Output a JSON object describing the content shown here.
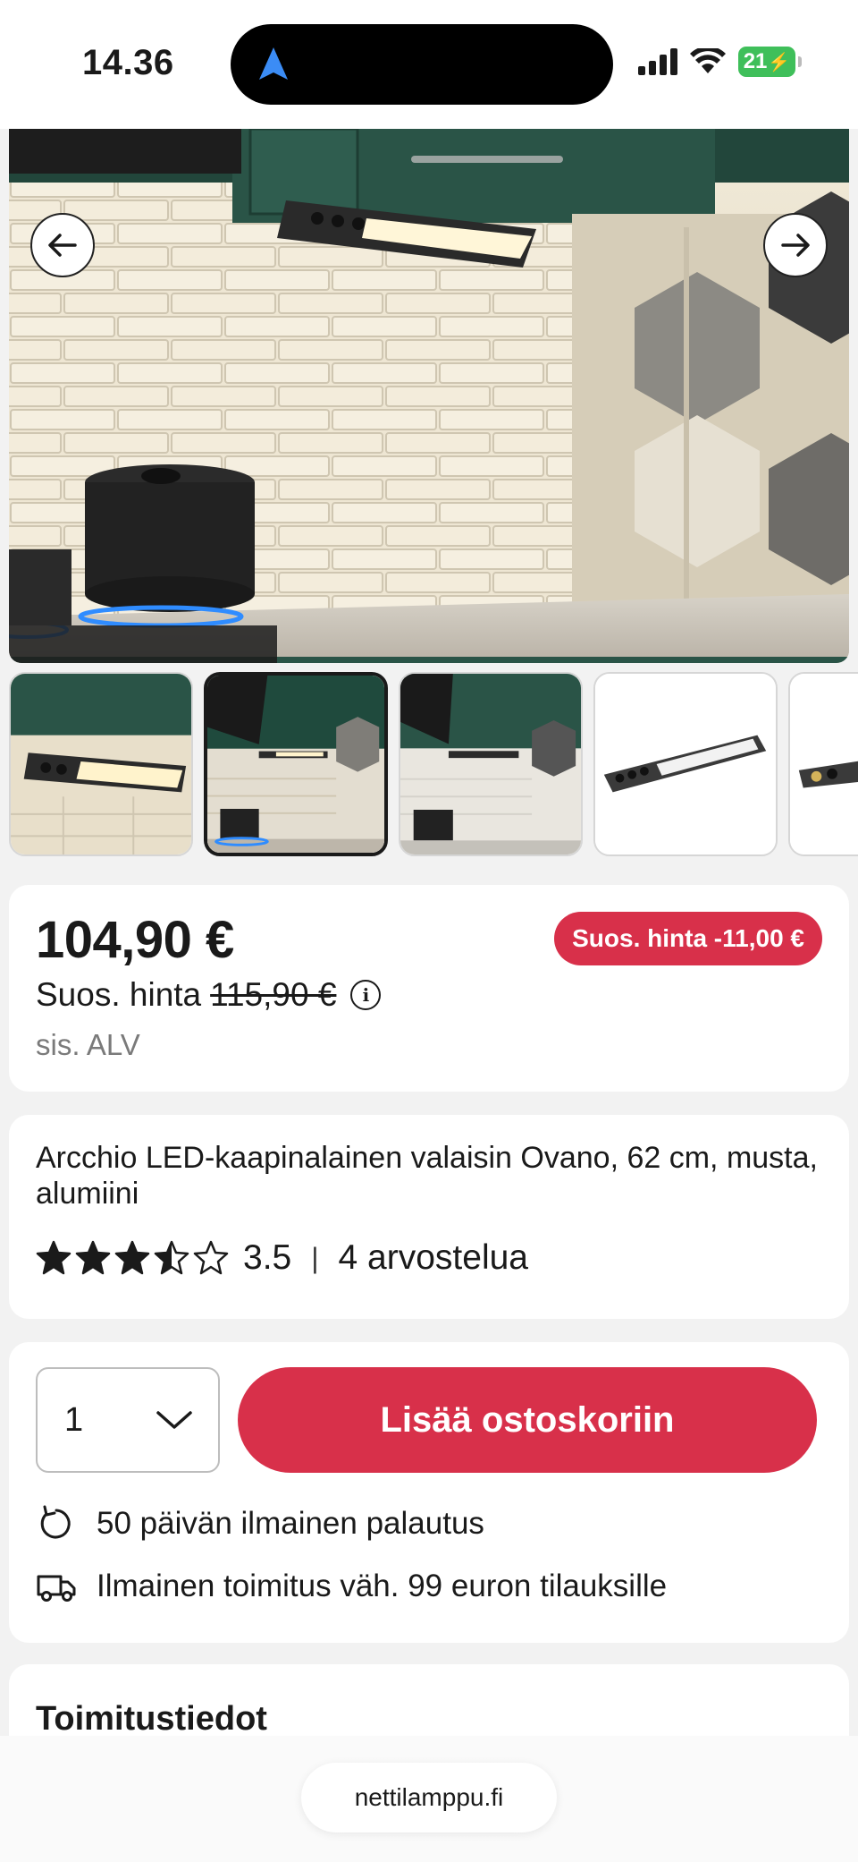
{
  "status_bar": {
    "time": "14.36",
    "battery": "21"
  },
  "gallery": {
    "prev_label": "previous-image",
    "next_label": "next-image",
    "thumbnail_count": 5,
    "active_thumbnail": 2
  },
  "price": {
    "current": "104,90 €",
    "discount_badge": "Suos. hinta -11,00 €",
    "recommended_prefix": "Suos. hinta",
    "recommended_old": "115,90 €",
    "vat_note": "sis. ALV"
  },
  "product": {
    "title": "Arcchio LED-kaapinalainen valaisin Ovano, 62 cm, musta, alumiini",
    "rating_value": "3.5",
    "rating_fraction": 0.7,
    "reviews": "4 arvostelua",
    "separator": "|"
  },
  "cart": {
    "quantity": "1",
    "add_button": "Lisää ostoskoriin",
    "return_policy": "50 päivän ilmainen palautus",
    "free_shipping": "Ilmainen toimitus väh. 99 euron tilauksille"
  },
  "delivery": {
    "heading": "Toimitustiedot"
  },
  "browser": {
    "url": "nettilamppu.fi"
  },
  "colors": {
    "accent": "#d8304a",
    "battery": "#3fbf5a"
  }
}
